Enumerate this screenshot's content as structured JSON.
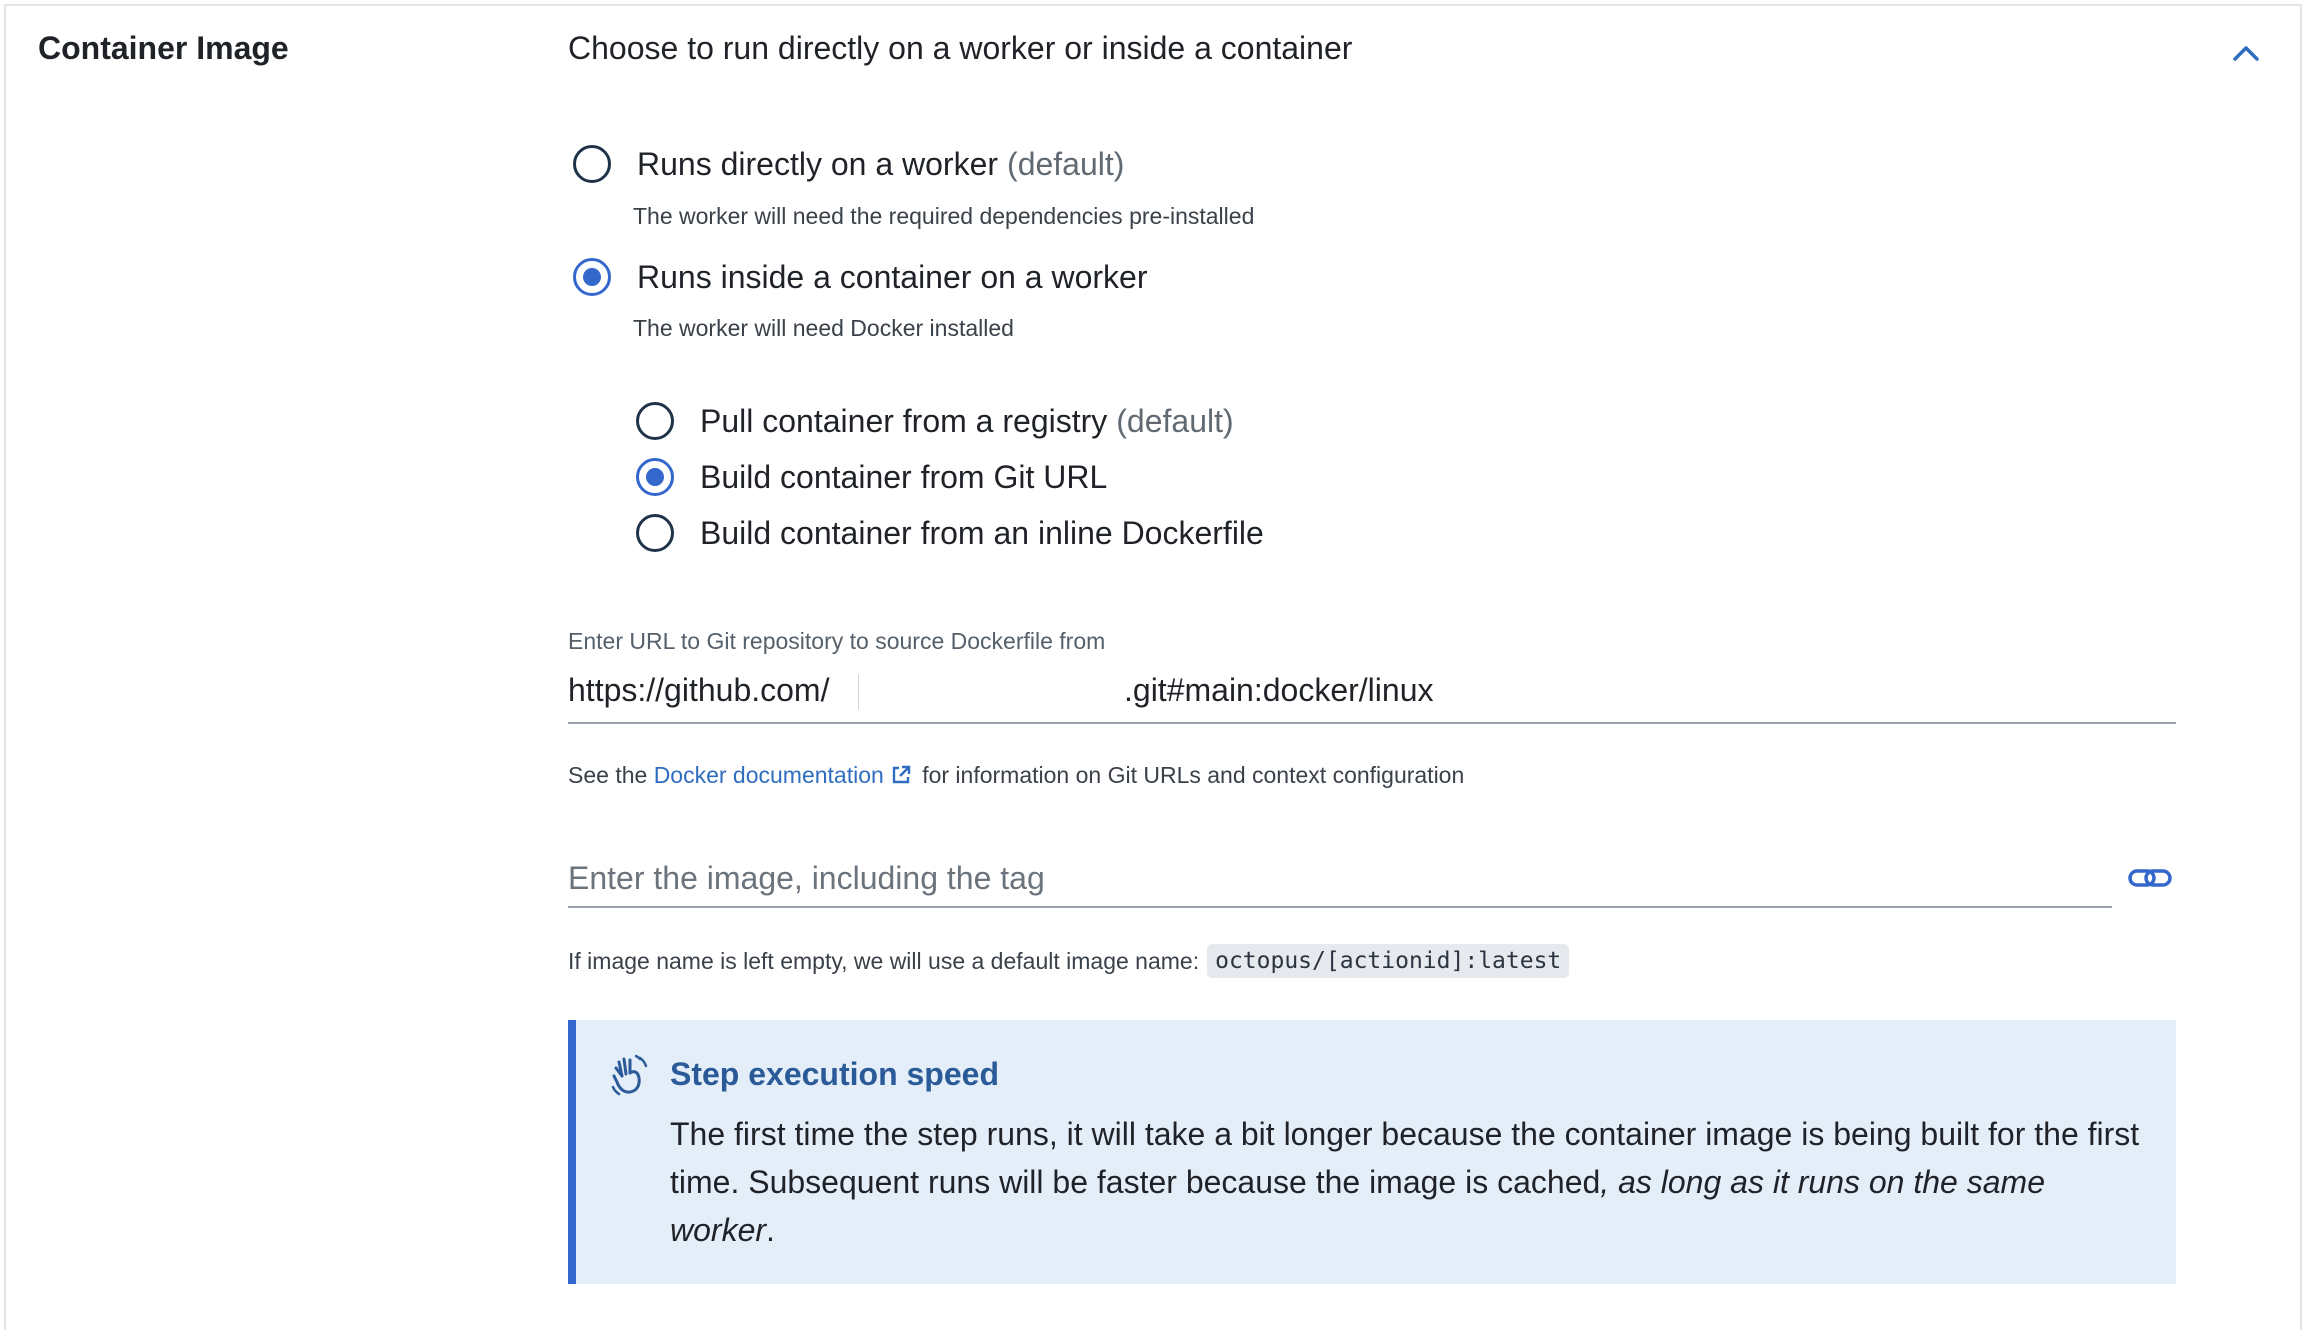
{
  "section": {
    "title": "Container Image",
    "summary": "Choose to run directly on a worker or inside a container",
    "collapse_icon": "chevron-up-icon"
  },
  "run_mode": {
    "options": [
      {
        "label": "Runs directly on a worker",
        "suffix": "(default)",
        "help": "The worker will need the required dependencies pre-installed",
        "selected": false
      },
      {
        "label": "Runs inside a container on a worker",
        "suffix": "",
        "help": "The worker will need Docker installed",
        "selected": true
      }
    ]
  },
  "container_source": {
    "options": [
      {
        "label": "Pull container from a registry",
        "suffix": "(default)",
        "selected": false
      },
      {
        "label": "Build container from Git URL",
        "suffix": "",
        "selected": true
      },
      {
        "label": "Build container from an inline Dockerfile",
        "suffix": "",
        "selected": false
      }
    ]
  },
  "git_url": {
    "label": "Enter URL to Git repository to source Dockerfile from",
    "value_prefix": "https://github.com/",
    "value_suffix": ".git#main:docker/linux"
  },
  "docs_note": {
    "before": "See the ",
    "link": "Docker documentation",
    "after": " for information on Git URLs and context configuration"
  },
  "image_field": {
    "placeholder": "Enter the image, including the tag",
    "value": ""
  },
  "default_image_note": {
    "text": "If image name is left empty, we will use a default image name:",
    "code": "octopus/[actionid]:latest"
  },
  "callout": {
    "title": "Step execution speed",
    "body_plain": "The first time the step runs, it will take a bit longer because the container image is being built for the first time. Subsequent runs will be faster because the image is cached",
    "body_italic": ", as long as it runs on the same worker",
    "body_end": "."
  },
  "colors": {
    "accent": "#3467cc",
    "link": "#2f6dc0",
    "callout_bg": "#e4eef9",
    "callout_title": "#2a5a98"
  }
}
